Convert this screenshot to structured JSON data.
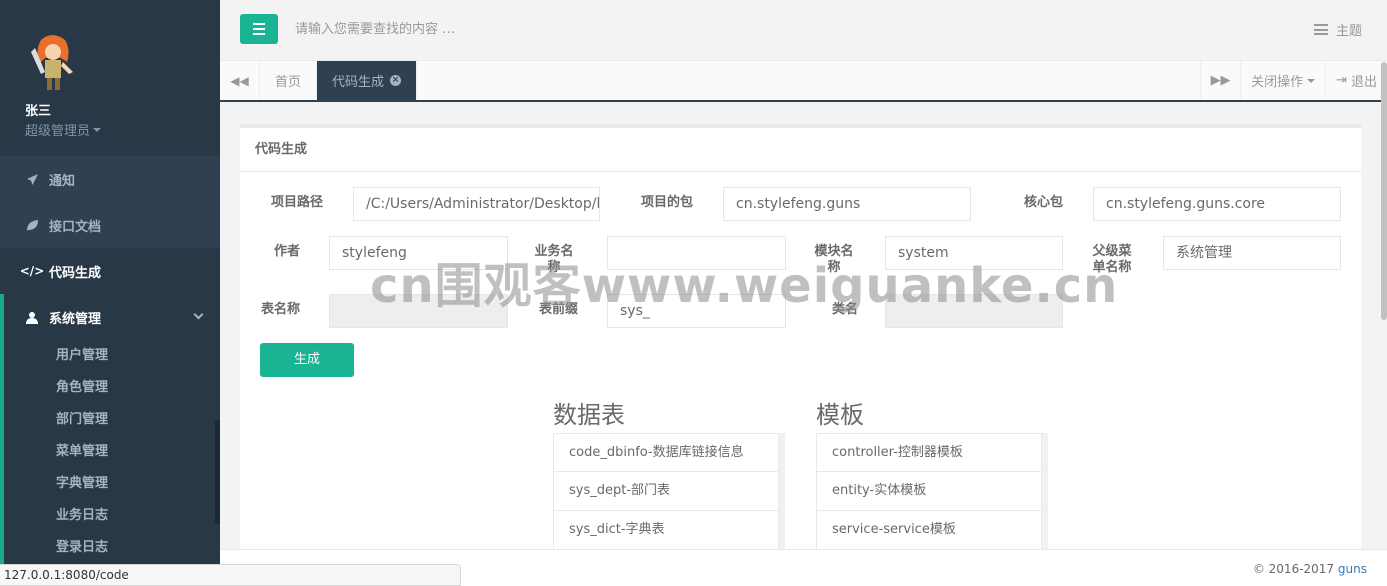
{
  "sidebar": {
    "user_name": "张三",
    "user_role": "超级管理员",
    "items": [
      {
        "label": "通知",
        "icon": "paper-plane-icon"
      },
      {
        "label": "接口文档",
        "icon": "leaf-icon"
      },
      {
        "label": "代码生成",
        "icon": "code-icon"
      },
      {
        "label": "系统管理",
        "icon": "user-icon"
      }
    ],
    "submenu": [
      "用户管理",
      "角色管理",
      "部门管理",
      "菜单管理",
      "字典管理",
      "业务日志",
      "登录日志"
    ]
  },
  "header": {
    "search_placeholder": "请输入您需要查找的内容 …",
    "theme_label": "主题"
  },
  "tabs": {
    "items": [
      {
        "label": "首页"
      },
      {
        "label": "代码生成"
      }
    ],
    "close_ops": "关闭操作",
    "logout": "退出"
  },
  "panel": {
    "title": "代码生成",
    "fields": {
      "project_path_label": "项目路径",
      "project_path_value": "/C:/Users/Administrator/Desktop/lea",
      "project_pkg_label": "项目的包",
      "project_pkg_value": "cn.stylefeng.guns",
      "core_pkg_label": "核心包",
      "core_pkg_value": "cn.stylefeng.guns.core",
      "author_label": "作者",
      "author_value": "stylefeng",
      "biz_name_label": "业务名称",
      "biz_name_value": "",
      "module_name_label": "模块名称",
      "module_name_value": "system",
      "parent_menu_label": "父级菜单名称",
      "parent_menu_value": "系统管理",
      "table_name_label": "表名称",
      "table_name_value": "",
      "table_prefix_label": "表前缀",
      "table_prefix_value": "sys_",
      "class_name_label": "类名",
      "class_name_value": ""
    },
    "generate_label": "生成",
    "tables_title": "数据表",
    "tables": [
      "code_dbinfo-数据库链接信息",
      "sys_dept-部门表",
      "sys_dict-字典表"
    ],
    "templates_title": "模板",
    "templates": [
      "controller-控制器模板",
      "entity-实体模板",
      "service-service模板"
    ]
  },
  "watermark": "cn围观客www.weiguanke.cn",
  "footer": {
    "copyright": "© 2016-2017",
    "link": "guns",
    "status_url": "127.0.0.1:8080/code"
  },
  "colors": {
    "accent": "#1ab394",
    "sidebar": "#2f4050",
    "sidebar_dark": "#293846"
  }
}
